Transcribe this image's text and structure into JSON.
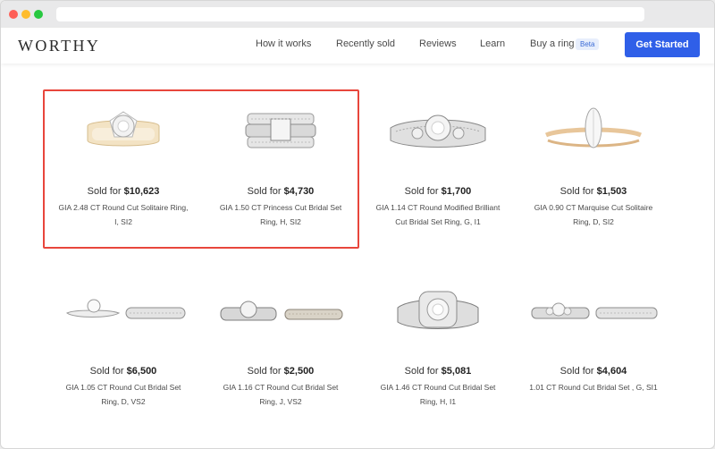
{
  "nav": {
    "logo": "WORTHY",
    "links": [
      "How it works",
      "Recently sold",
      "Reviews",
      "Learn",
      "Buy a ring"
    ],
    "badge": "Beta",
    "cta": "Get Started"
  },
  "sold_prefix": "Sold for",
  "items": [
    {
      "price": "$10,623",
      "desc1": "GIA 2.48 CT Round Cut Solitaire Ring,",
      "desc2": "I, SI2"
    },
    {
      "price": "$4,730",
      "desc1": "GIA 1.50 CT Princess Cut Bridal Set",
      "desc2": "Ring, H, SI2"
    },
    {
      "price": "$1,700",
      "desc1": "GIA 1.14 CT Round Modified Brilliant",
      "desc2": "Cut Bridal Set Ring, G, I1"
    },
    {
      "price": "$1,503",
      "desc1": "GIA 0.90 CT Marquise Cut Solitaire",
      "desc2": "Ring, D, SI2"
    },
    {
      "price": "$6,500",
      "desc1": "GIA 1.05 CT Round Cut Bridal Set",
      "desc2": "Ring, D, VS2"
    },
    {
      "price": "$2,500",
      "desc1": "GIA 1.16 CT Round Cut Bridal Set",
      "desc2": "Ring, J, VS2"
    },
    {
      "price": "$5,081",
      "desc1": "GIA 1.46 CT Round Cut Bridal Set",
      "desc2": "Ring, H, I1"
    },
    {
      "price": "$4,604",
      "desc1": "1.01 CT Round Cut Bridal Set , G, SI1",
      "desc2": ""
    }
  ]
}
